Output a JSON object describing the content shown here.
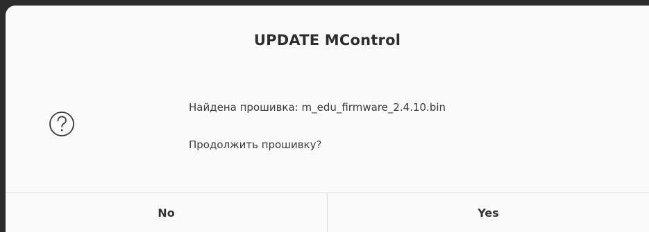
{
  "dialog": {
    "title": "UPDATE MControl",
    "icon": "question-icon",
    "message_line1": "Найдена прошивка: m_edu_firmware_2.4.10.bin",
    "message_line2": "Продолжить прошивку?",
    "buttons": {
      "no_label": "No",
      "yes_label": "Yes"
    }
  },
  "colors": {
    "backdrop": "#2b2b2b",
    "dialog_bg": "#fafafa",
    "text": "#3a3a3a",
    "divider": "#dcdcdc"
  }
}
